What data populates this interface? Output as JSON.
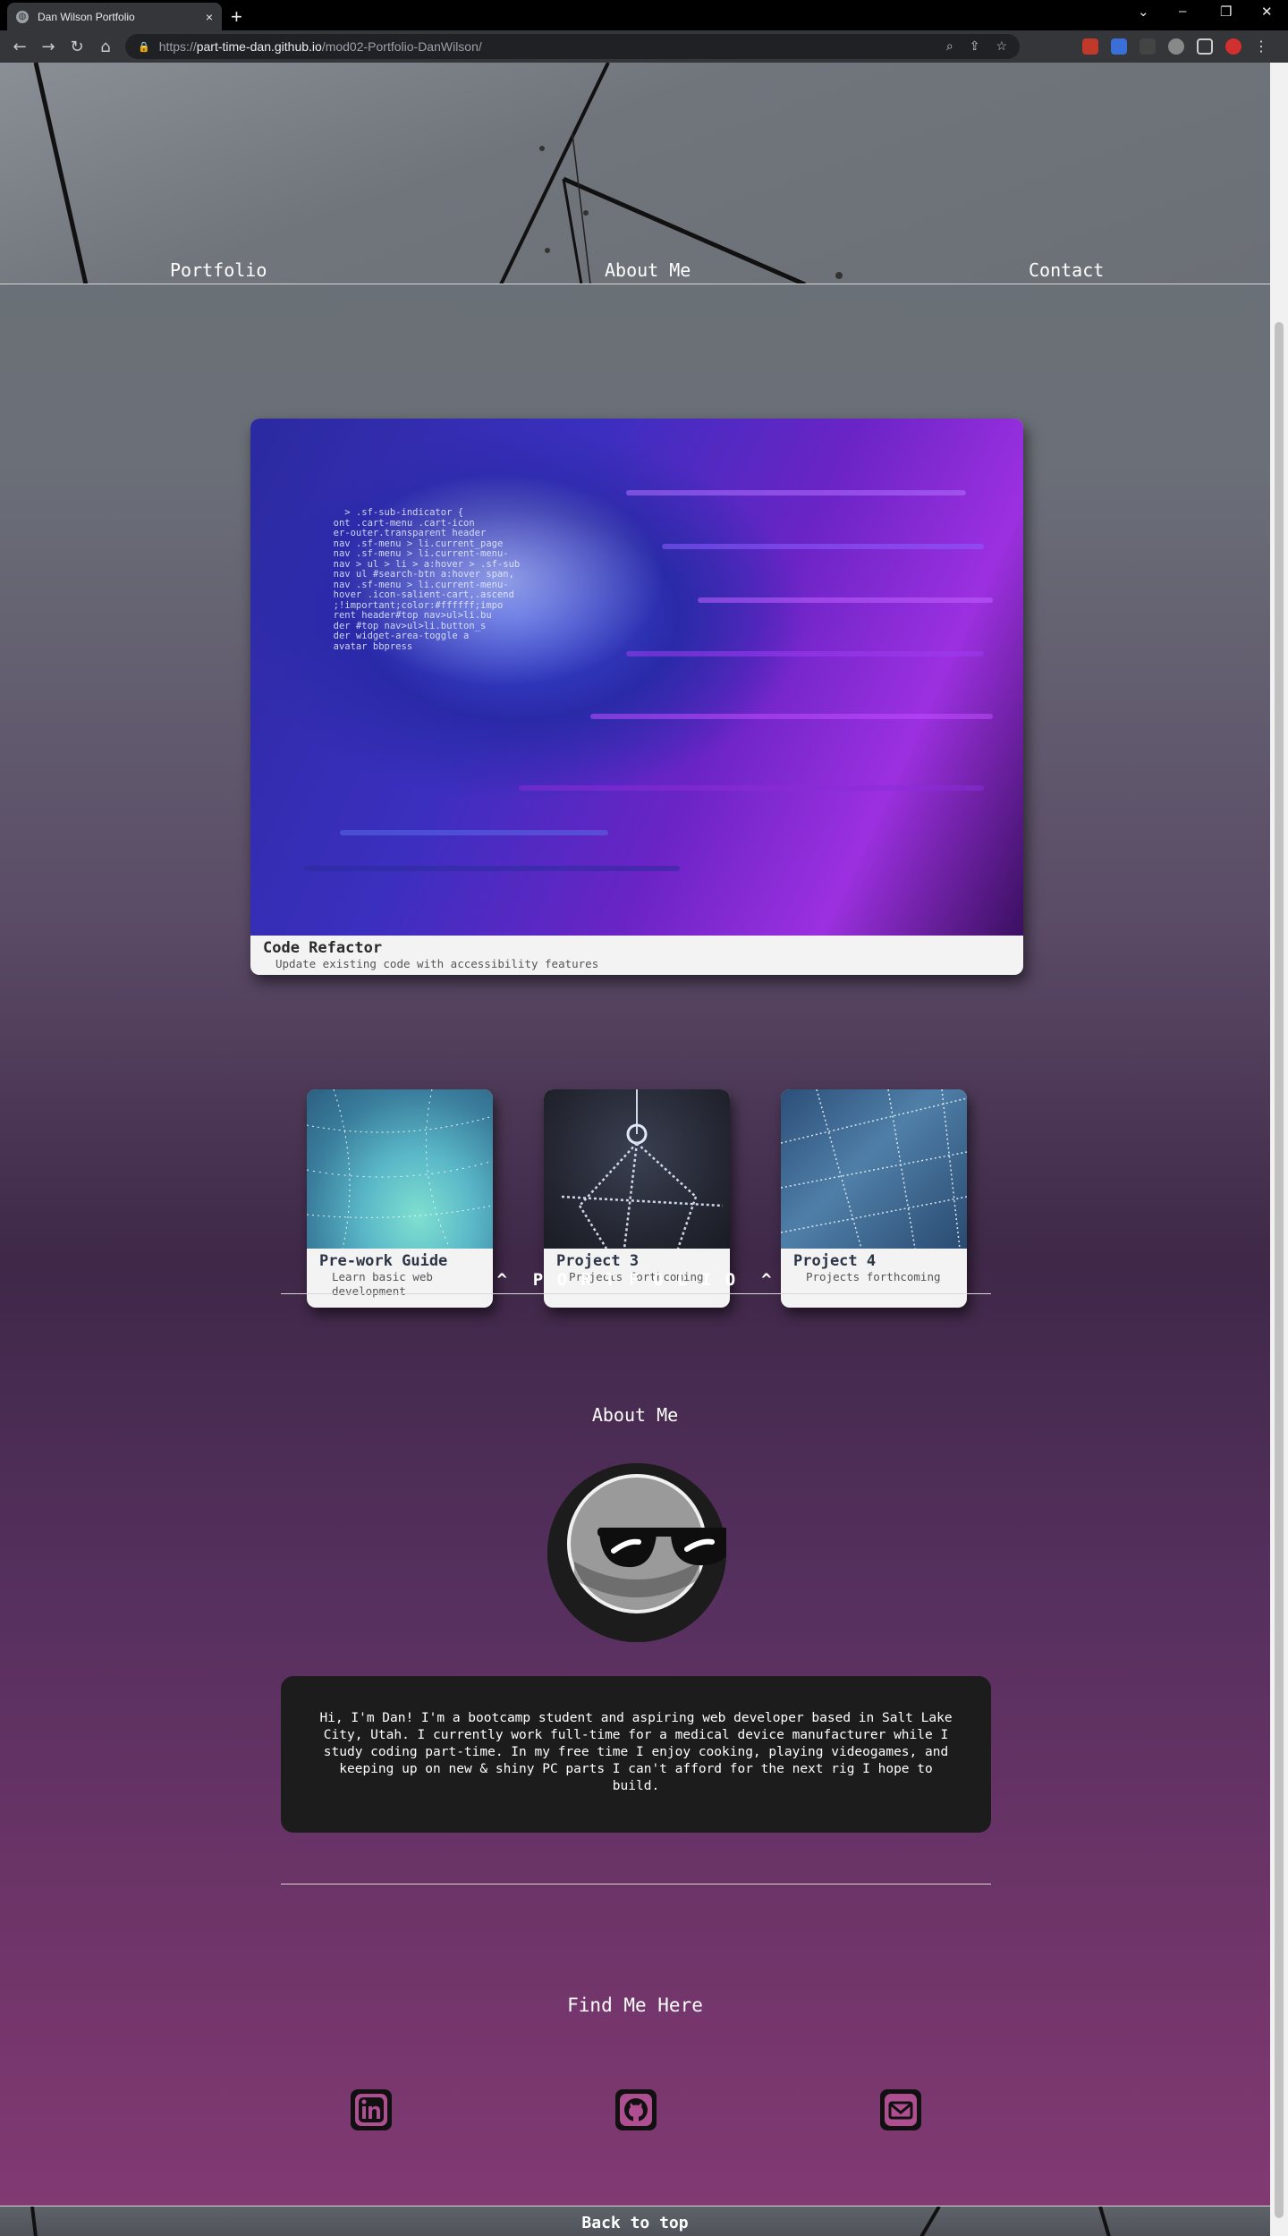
{
  "browser": {
    "tab_title": "Dan Wilson Portfolio",
    "tab_close": "×",
    "new_tab": "+",
    "url_prefix": "https://",
    "url_host": "part-time-dan.github.io",
    "url_path": "/mod02-Portfolio-DanWilson/",
    "controls": [
      "⌄",
      "–",
      "❐",
      "✕"
    ]
  },
  "nav": {
    "portfolio": "Portfolio",
    "about": "About Me",
    "contact": "Contact"
  },
  "featured": {
    "title": "Code Refactor",
    "subtitle": "Update existing code with accessibility features",
    "code_lines": [
      "    > .sf-sub-indicator {",
      "  ont .cart-menu .cart-icon",
      "  er-outer.transparent header",
      "  nav .sf-menu > li.current_page",
      "  nav .sf-menu > li.current-menu-",
      "  nav > ul > li > a:hover > .sf-sub",
      "  nav ul #search-btn a:hover span,",
      "  nav .sf-menu > li.current-menu-",
      "  hover .icon-salient-cart,.ascend",
      "  ;!important;color:#ffffff;impo",
      "  rent header#top nav>ul>li.bu",
      "  der #top nav>ul>li.button_s",
      "  der widget-area-toggle a",
      "  avatar bbpress"
    ]
  },
  "projects": [
    {
      "title": "Pre-work Guide",
      "subtitle": "Learn basic web development"
    },
    {
      "title": "Project 3",
      "subtitle": "Projects forthcoming"
    },
    {
      "title": "Project 4",
      "subtitle": "Projects forthcoming"
    }
  ],
  "portfolio_heading": "^  P O R T F O L I O  ^",
  "about": {
    "heading": "About Me",
    "bio": "Hi, I'm Dan! I'm a bootcamp student and aspiring web developer based in Salt Lake City, Utah. I currently work full-time for a medical device manufacturer while I study coding part-time. In my free time I enjoy cooking, playing videogames, and keeping up on new & shiny PC parts I can't afford for the next rig I hope to build."
  },
  "contact": {
    "heading": "Find Me Here",
    "links": [
      "linkedin-icon",
      "github-icon",
      "email-icon"
    ]
  },
  "footer": {
    "back_to_top": "Back to top"
  },
  "colors": {
    "card_bg": "#f3f3f3",
    "bio_bg": "#1c1c1c",
    "page_top": "#6b7078",
    "page_bottom": "#843a74"
  }
}
